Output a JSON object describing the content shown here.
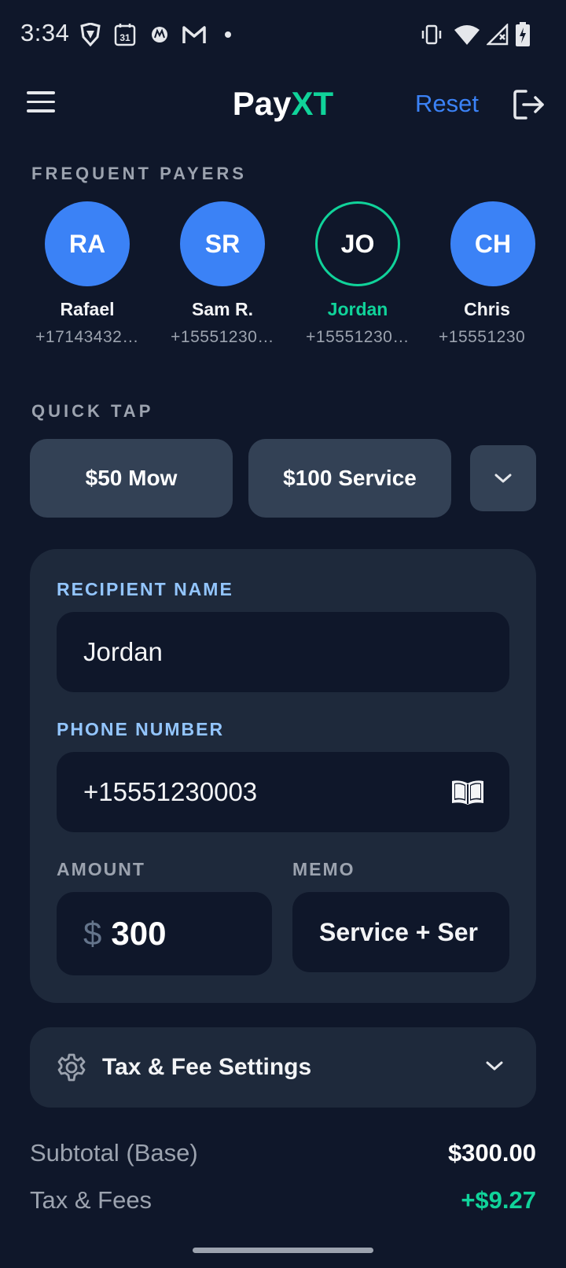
{
  "status_bar": {
    "time": "3:34",
    "left_icons": [
      "vpn-shield-icon",
      "calendar-31-icon",
      "motorola-icon",
      "gmail-icon",
      "dot-icon"
    ],
    "right_icons": [
      "vibrate-icon",
      "wifi-icon",
      "signal-icon",
      "battery-charging-icon"
    ],
    "calendar_day": "31"
  },
  "header": {
    "title_part1": "Pay",
    "title_part2": "XT",
    "reset_label": "Reset",
    "accent_color": "#10d39a",
    "link_color": "#3b82f6"
  },
  "frequent_payers": {
    "label": "FREQUENT PAYERS",
    "items": [
      {
        "initials": "RA",
        "name": "Rafael",
        "phone": "+17143432…",
        "selected": false
      },
      {
        "initials": "SR",
        "name": "Sam R.",
        "phone": "+15551230…",
        "selected": false
      },
      {
        "initials": "JO",
        "name": "Jordan",
        "phone": "+15551230…",
        "selected": true
      },
      {
        "initials": "CH",
        "name": "Chris",
        "phone": "+15551230",
        "selected": false
      }
    ]
  },
  "quick_tap": {
    "label": "QUICK TAP",
    "buttons": [
      {
        "label": "$50 Mow"
      },
      {
        "label": "$100 Service"
      }
    ]
  },
  "form": {
    "recipient_label": "RECIPIENT NAME",
    "recipient_value": "Jordan",
    "phone_label": "PHONE NUMBER",
    "phone_value": "+15551230003",
    "amount_label": "AMOUNT",
    "currency_symbol": "$",
    "amount_value": "300",
    "memo_label": "MEMO",
    "memo_value": "Service + Ser"
  },
  "settings": {
    "label": "Tax & Fee Settings"
  },
  "summary": {
    "subtotal_label": "Subtotal (Base)",
    "subtotal_value": "$300.00",
    "fees_label": "Tax & Fees",
    "fees_value": "+$9.27"
  }
}
